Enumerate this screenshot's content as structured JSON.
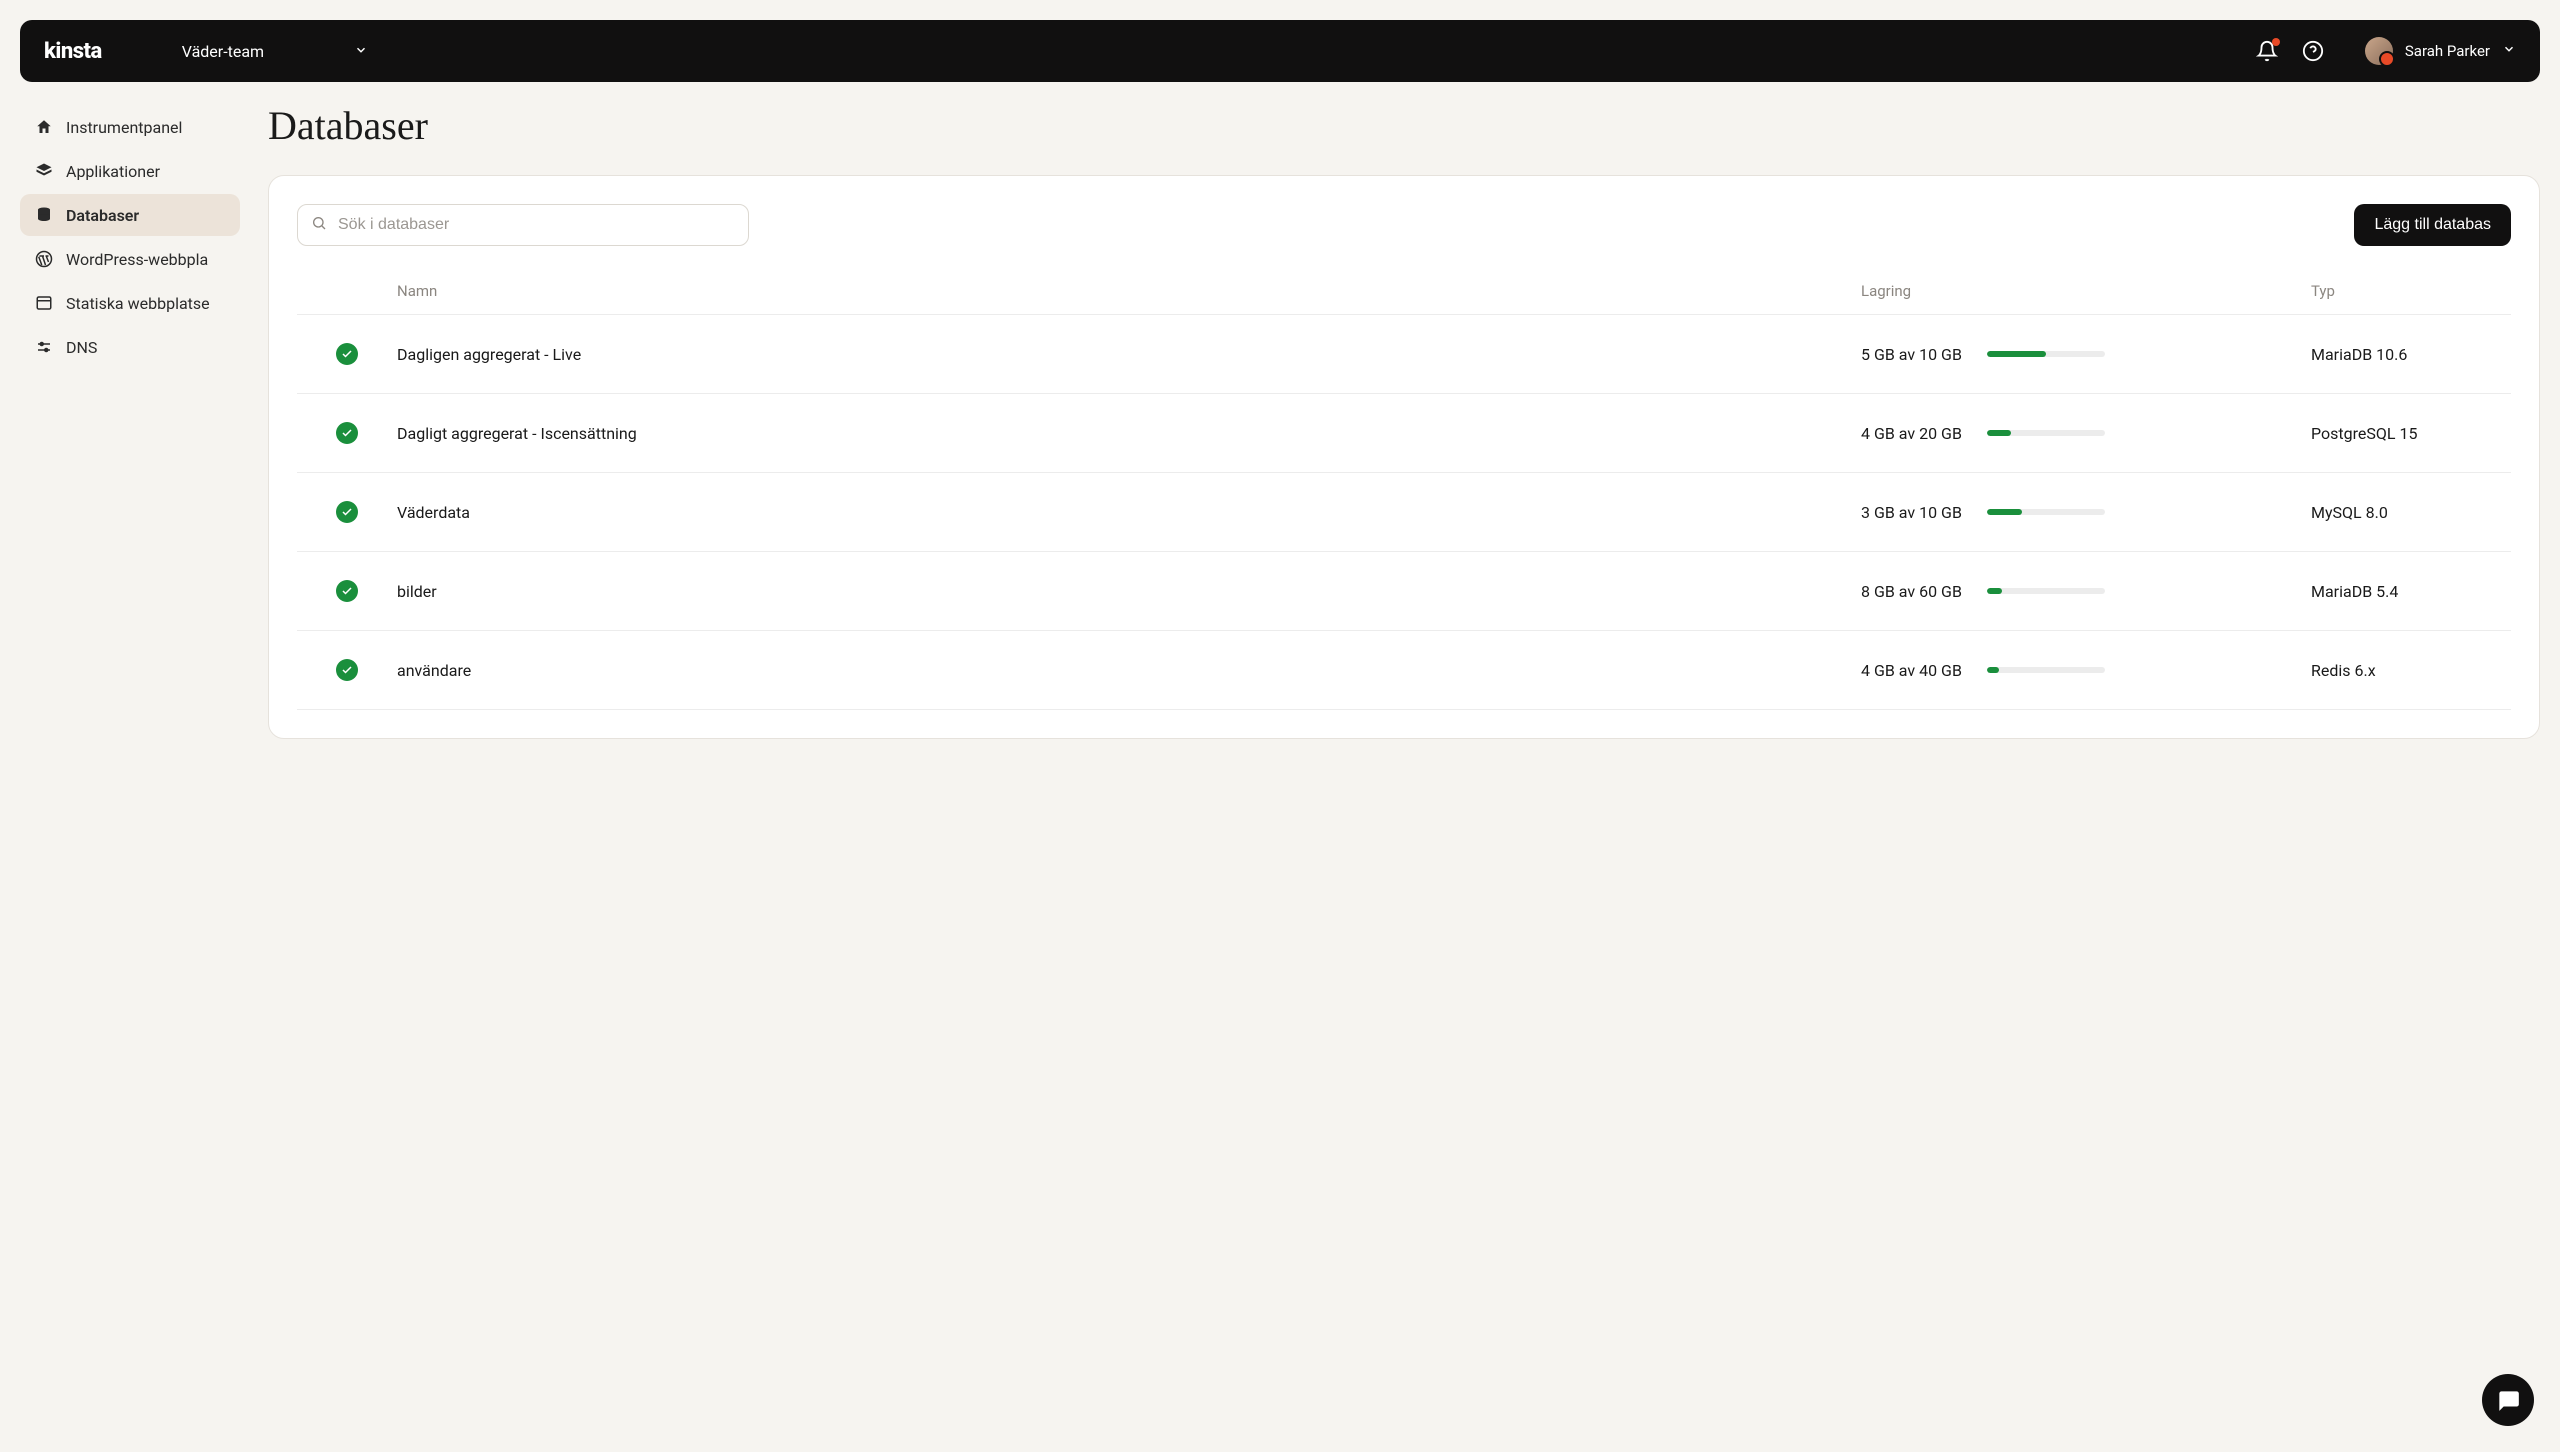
{
  "brand": "kinsta",
  "team": "Väder-team",
  "user_name": "Sarah Parker",
  "page_title": "Databaser",
  "search_placeholder": "Sök i databaser",
  "add_button": "Lägg till databas",
  "sidebar": {
    "items": [
      {
        "label": "Instrumentpanel",
        "icon": "home"
      },
      {
        "label": "Applikationer",
        "icon": "layers"
      },
      {
        "label": "Databaser",
        "icon": "database",
        "active": true
      },
      {
        "label": "WordPress-webbpla",
        "icon": "wordpress"
      },
      {
        "label": "Statiska webbplatse",
        "icon": "browser"
      },
      {
        "label": "DNS",
        "icon": "sliders"
      }
    ]
  },
  "table": {
    "headers": {
      "name": "Namn",
      "storage": "Lagring",
      "type": "Typ"
    },
    "rows": [
      {
        "name": "Dagligen aggregerat - Live",
        "storage_text": "5 GB av 10 GB",
        "percent": 50,
        "type": "MariaDB 10.6"
      },
      {
        "name": "Dagligt aggregerat - Iscensättning",
        "storage_text": "4 GB av 20 GB",
        "percent": 20,
        "type": "PostgreSQL 15"
      },
      {
        "name": "Väderdata",
        "storage_text": "3 GB av 10 GB",
        "percent": 30,
        "type": "MySQL 8.0"
      },
      {
        "name": "bilder",
        "storage_text": "8 GB av 60 GB",
        "percent": 13,
        "type": "MariaDB 5.4"
      },
      {
        "name": "användare",
        "storage_text": "4 GB av 40 GB",
        "percent": 10,
        "type": "Redis 6.x"
      }
    ]
  }
}
